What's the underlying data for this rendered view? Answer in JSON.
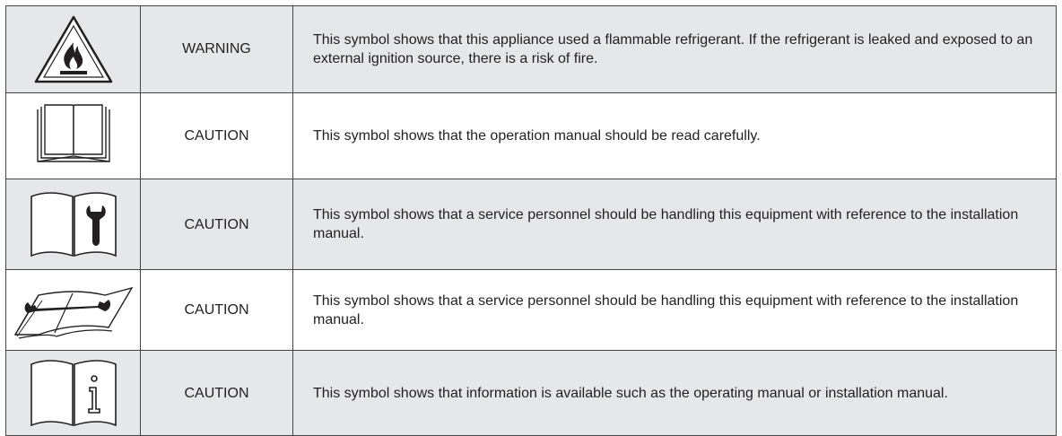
{
  "rows": [
    {
      "icon": "flammable-warning-icon",
      "level": "WARNING",
      "description": "This symbol shows that this appliance used a flammable refrigerant. If the refrigerant is leaked and exposed to an external ignition source, there is a risk of fire."
    },
    {
      "icon": "read-manual-icon",
      "level": "CAUTION",
      "description": "This symbol shows that the operation manual should be read carefully."
    },
    {
      "icon": "service-manual-icon",
      "level": "CAUTION",
      "description": "This symbol shows that a service personnel should be handling this equipment with reference to the installation manual."
    },
    {
      "icon": "open-book-wrench-icon",
      "level": "CAUTION",
      "description": "This symbol shows that a service personnel should be handling this equipment with reference to the installation manual."
    },
    {
      "icon": "information-manual-icon",
      "level": "CAUTION",
      "description": "This symbol shows that information is available such as the operating manual or installation manual."
    }
  ]
}
